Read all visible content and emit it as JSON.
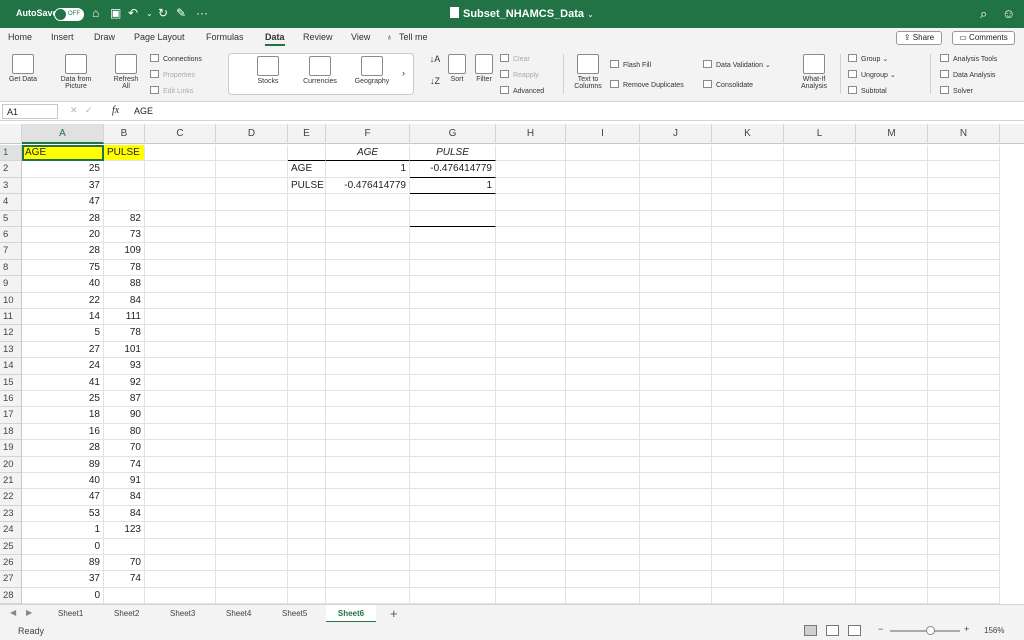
{
  "titlebar": {
    "autosave_label": "AutoSave",
    "autosave_state": "OFF",
    "more": "···",
    "document_title": "Subset_NHAMCS_Data"
  },
  "menu": {
    "tabs": [
      "Home",
      "Insert",
      "Draw",
      "Page Layout",
      "Formulas",
      "Data",
      "Review",
      "View"
    ],
    "active_tab": "Data",
    "tell_me": "Tell me",
    "share": "Share",
    "comments": "Comments"
  },
  "ribbon": {
    "get_data": "Get Data",
    "data_from_picture_1": "Data from",
    "data_from_picture_2": "Picture",
    "refresh_1": "Refresh",
    "refresh_2": "All",
    "connections": "Connections",
    "properties": "Properties",
    "edit_links": "Edit Links",
    "stocks": "Stocks",
    "currencies": "Currencies",
    "geography": "Geography",
    "sort": "Sort",
    "filter": "Filter",
    "clear": "Clear",
    "reapply": "Reapply",
    "advanced": "Advanced",
    "text_to_columns_1": "Text to",
    "text_to_columns_2": "Columns",
    "flash_fill": "Flash Fill",
    "remove_duplicates": "Remove Duplicates",
    "data_validation": "Data Validation",
    "consolidate": "Consolidate",
    "what_if_1": "What-If",
    "what_if_2": "Analysis",
    "group": "Group",
    "ungroup": "Ungroup",
    "subtotal": "Subtotal",
    "analysis_tools": "Analysis Tools",
    "data_analysis": "Data Analysis",
    "solver": "Solver"
  },
  "formula_bar": {
    "name_box": "A1",
    "fx": "fx",
    "content": "AGE"
  },
  "columns": [
    "A",
    "B",
    "C",
    "D",
    "E",
    "F",
    "G",
    "H",
    "I",
    "J",
    "K",
    "L",
    "M",
    "N"
  ],
  "row_numbers": [
    "1",
    "2",
    "3",
    "4",
    "5",
    "6",
    "7",
    "8",
    "9",
    "10",
    "11",
    "12",
    "13",
    "14",
    "15",
    "16",
    "17",
    "18",
    "19",
    "20",
    "21",
    "22",
    "23",
    "24",
    "25",
    "26",
    "27",
    "28"
  ],
  "cells": {
    "A": [
      "AGE",
      "25",
      "37",
      "47",
      "28",
      "20",
      "28",
      "75",
      "40",
      "22",
      "14",
      "5",
      "27",
      "24",
      "41",
      "25",
      "18",
      "16",
      "28",
      "89",
      "40",
      "47",
      "53",
      "1",
      "0",
      "89",
      "37",
      "0"
    ],
    "B": [
      "PULSE",
      "",
      "",
      "",
      "82",
      "73",
      "109",
      "78",
      "88",
      "84",
      "111",
      "78",
      "101",
      "93",
      "92",
      "87",
      "90",
      "80",
      "70",
      "74",
      "91",
      "84",
      "84",
      "123",
      "",
      "70",
      "74",
      ""
    ]
  },
  "correlation_table": {
    "col_header_age": "AGE",
    "col_header_pulse": "PULSE",
    "row1_label": "AGE",
    "row1_age": "1",
    "row1_pulse": "-0.476414779",
    "row2_label": "PULSE",
    "row2_age": "-0.476414779",
    "row2_pulse": "1"
  },
  "sheets": [
    "Sheet1",
    "Sheet2",
    "Sheet3",
    "Sheet4",
    "Sheet5",
    "Sheet6"
  ],
  "active_sheet": "Sheet6",
  "status": {
    "ready": "Ready",
    "zoom": "156%"
  },
  "colors": {
    "excel_green": "#217346",
    "header_highlight": "#ffff00"
  }
}
